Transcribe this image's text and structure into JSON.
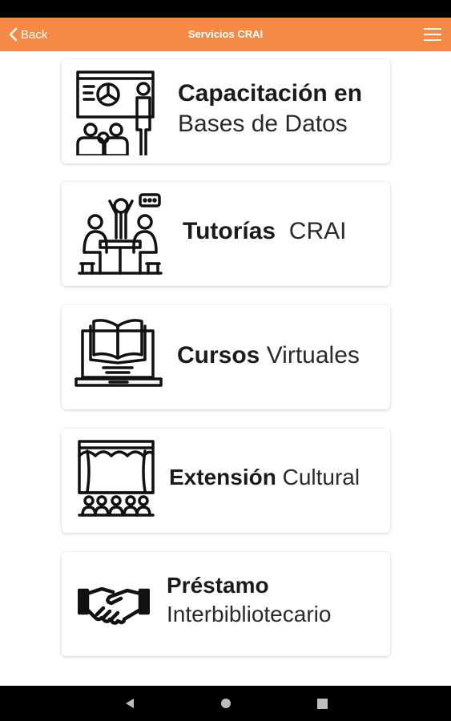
{
  "appbar": {
    "back_label": "Back",
    "title": "Servicios CRAI",
    "accent_color": "#f58a47",
    "menu_icon": "hamburger-menu-icon"
  },
  "cards": [
    {
      "bold": "Capacitación en",
      "light": "Bases de Datos",
      "icon": "presentation-training-icon"
    },
    {
      "bold": "Tutorías",
      "light": "CRAI",
      "icon": "tutoring-group-icon"
    },
    {
      "bold": "Cursos",
      "light": "Virtuales",
      "icon": "laptop-book-icon"
    },
    {
      "bold": "Extensión",
      "light": "Cultural",
      "icon": "theater-stage-icon"
    },
    {
      "bold": "Préstamo",
      "light": "Interbibliotecario",
      "icon": "handshake-icon"
    }
  ],
  "navbar": {
    "back_icon": "nav-back-icon",
    "home_icon": "nav-home-icon",
    "recents_icon": "nav-recents-icon"
  }
}
